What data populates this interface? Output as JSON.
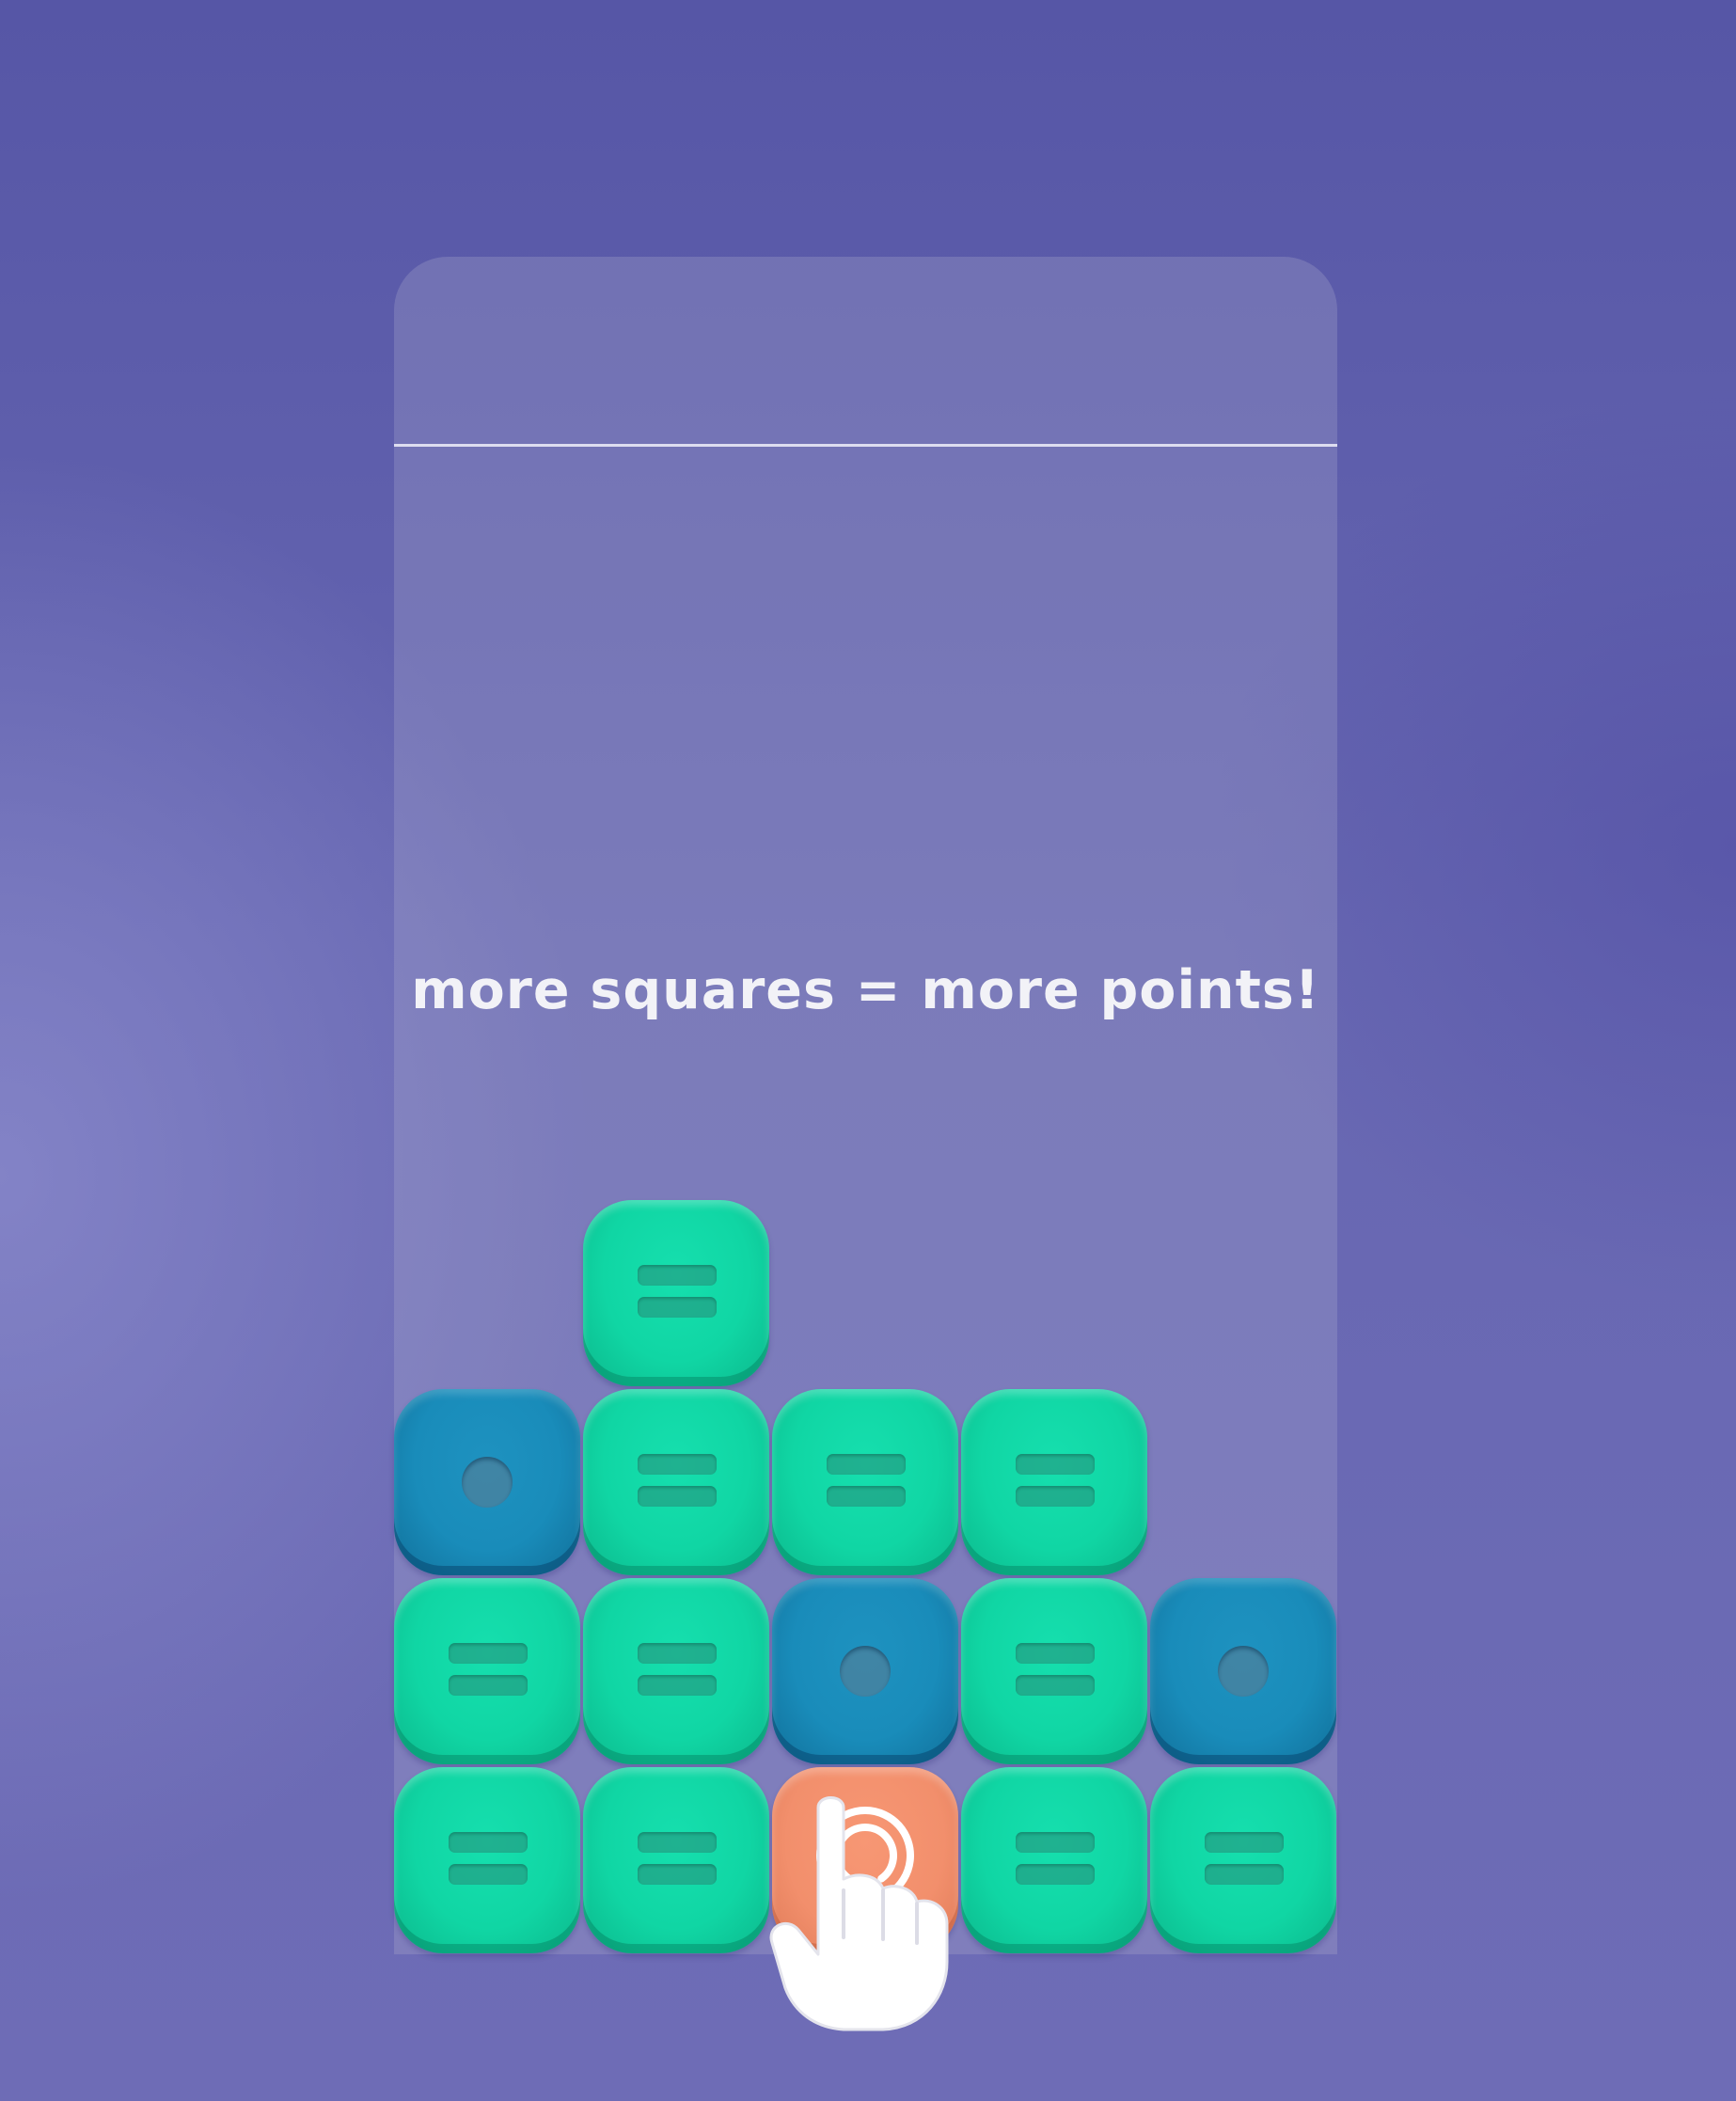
{
  "hint_text": "more squares = more points!",
  "colors": {
    "green": "#10d6a4",
    "blue": "#198cba",
    "orange": "#f28f6c",
    "background": "#6262ae"
  },
  "board": {
    "rows": [
      [
        "empty",
        "green",
        "empty",
        "empty",
        "empty"
      ],
      [
        "blue",
        "green",
        "green",
        "green",
        "empty"
      ],
      [
        "green",
        "green",
        "blue",
        "green",
        "blue"
      ],
      [
        "green",
        "green",
        "orange",
        "green",
        "green"
      ]
    ],
    "icons": {
      "green": "equals-icon",
      "blue": "dot-icon",
      "orange": "touch-icon"
    }
  },
  "pointer": "tap-hand-icon"
}
